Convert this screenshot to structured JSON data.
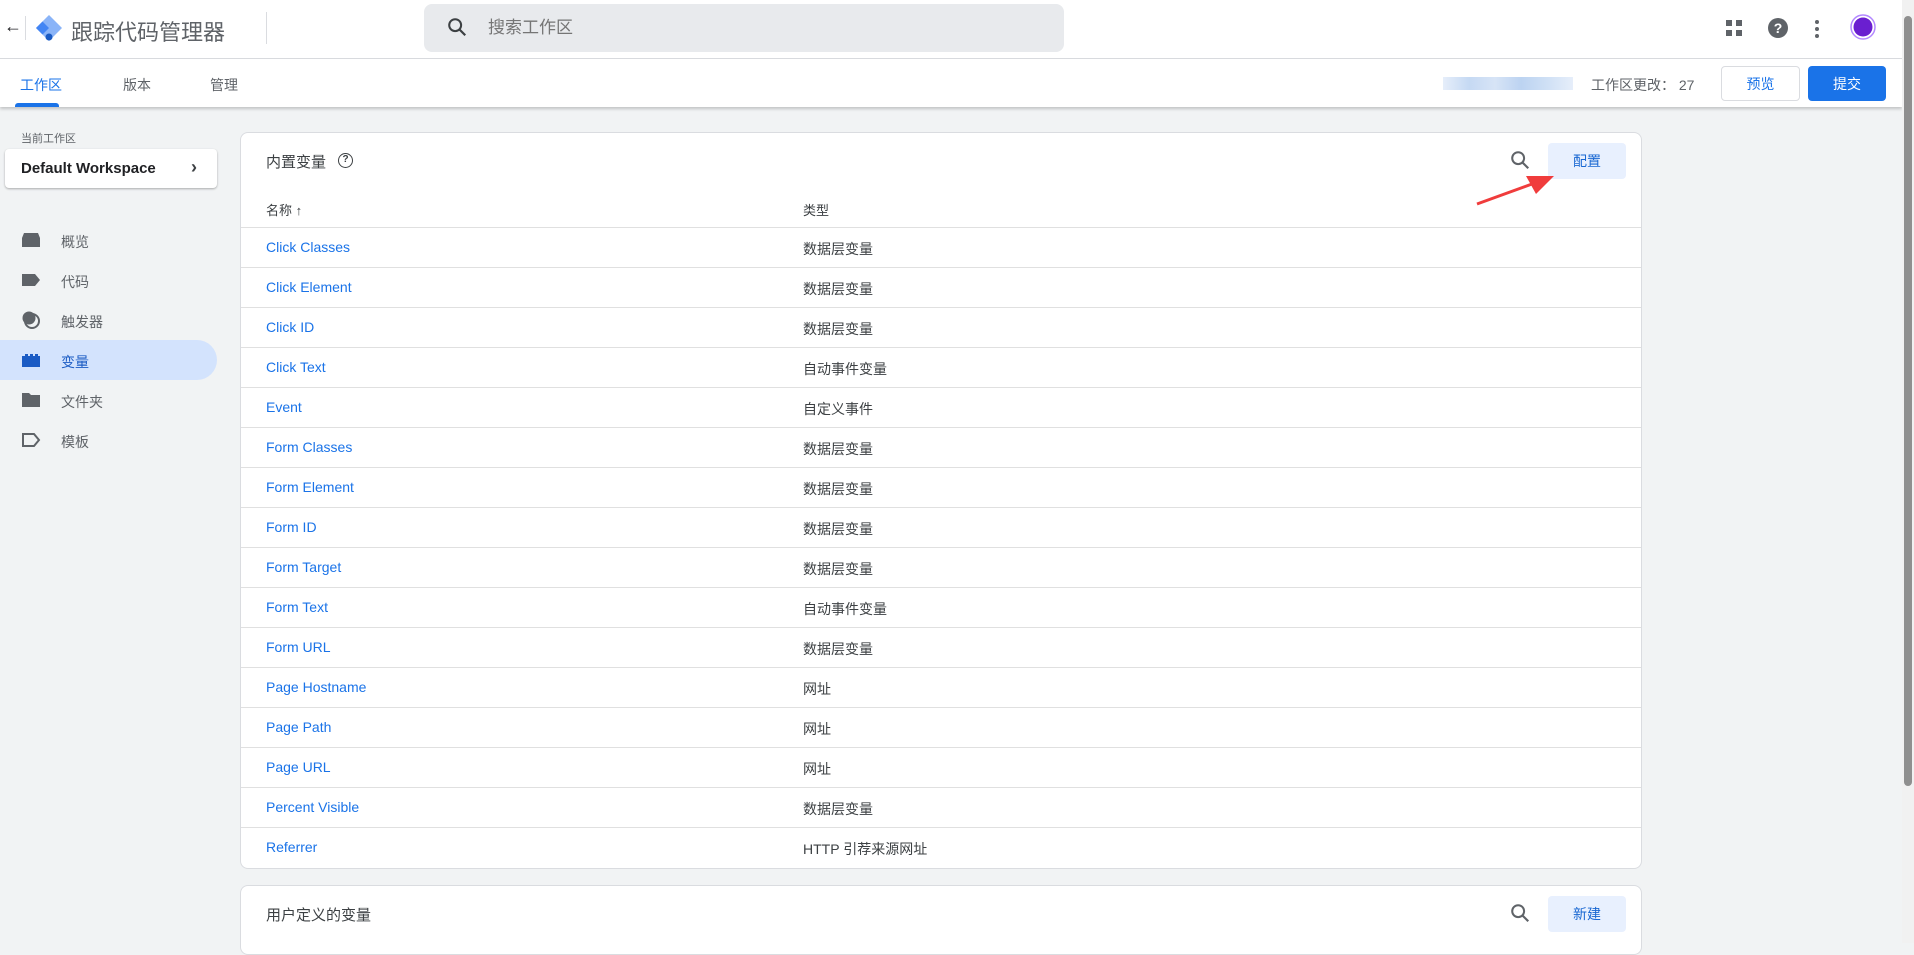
{
  "header": {
    "back_icon": "arrow-left",
    "app_title": "跟踪代码管理器",
    "search_placeholder": "搜索工作区"
  },
  "tabs": [
    {
      "label": "工作区"
    },
    {
      "label": "版本"
    },
    {
      "label": "管理"
    }
  ],
  "workspace_changes": "工作区更改： 27",
  "buttons": {
    "preview": "预览",
    "submit": "提交"
  },
  "sidebar": {
    "current_label": "当前工作区",
    "workspace": "Default Workspace",
    "items": [
      {
        "label": "概览"
      },
      {
        "label": "代码"
      },
      {
        "label": "触发器"
      },
      {
        "label": "变量"
      },
      {
        "label": "文件夹"
      },
      {
        "label": "模板"
      }
    ]
  },
  "builtin": {
    "title": "内置变量",
    "help": "?",
    "configure": "配置",
    "col_name": "名称 ↑",
    "col_type": "类型",
    "rows": [
      {
        "name": "Click Classes",
        "type": "数据层变量"
      },
      {
        "name": "Click Element",
        "type": "数据层变量"
      },
      {
        "name": "Click ID",
        "type": "数据层变量"
      },
      {
        "name": "Click Text",
        "type": "自动事件变量"
      },
      {
        "name": "Event",
        "type": "自定义事件"
      },
      {
        "name": "Form Classes",
        "type": "数据层变量"
      },
      {
        "name": "Form Element",
        "type": "数据层变量"
      },
      {
        "name": "Form ID",
        "type": "数据层变量"
      },
      {
        "name": "Form Target",
        "type": "数据层变量"
      },
      {
        "name": "Form Text",
        "type": "自动事件变量"
      },
      {
        "name": "Form URL",
        "type": "数据层变量"
      },
      {
        "name": "Page Hostname",
        "type": "网址"
      },
      {
        "name": "Page Path",
        "type": "网址"
      },
      {
        "name": "Page URL",
        "type": "网址"
      },
      {
        "name": "Percent Visible",
        "type": "数据层变量"
      },
      {
        "name": "Referrer",
        "type": "HTTP 引荐来源网址"
      }
    ]
  },
  "user_defined": {
    "title": "用户定义的变量",
    "new": "新建"
  },
  "colors": {
    "accent": "#1a73e8",
    "annotation": "#f03c3c"
  }
}
